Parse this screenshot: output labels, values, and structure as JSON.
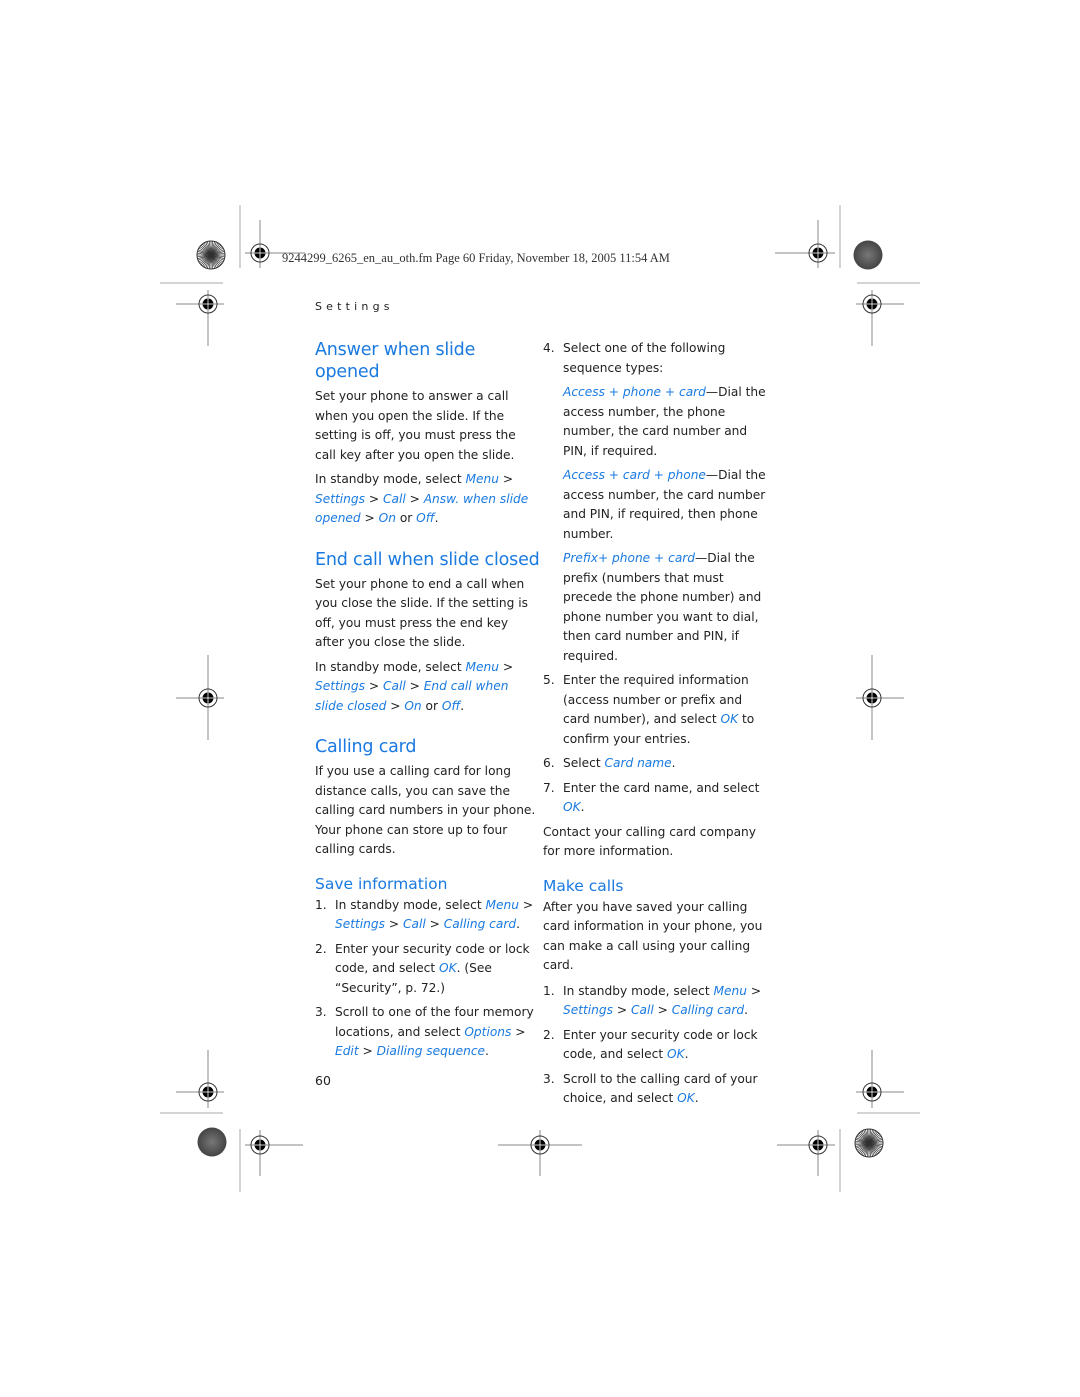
{
  "header": {
    "file_line": "9244299_6265_en_au_oth.fm  Page 60  Friday, November 18, 2005  11:54 AM",
    "running_head": "Settings"
  },
  "left_column": {
    "answer": {
      "title": "Answer when slide opened",
      "body": "Set your phone to answer a call when you open the slide. If the setting is off, you must press the call key after you open the slide.",
      "path_prefix": "In standby mode, select ",
      "menu": "Menu",
      "settings": "Settings",
      "call": "Call",
      "option": "Answ. when slide opened",
      "on": "On",
      "or": " or ",
      "off": "Off"
    },
    "endcall": {
      "title": "End call when slide closed",
      "body": "Set your phone to end a call when you close the slide. If the setting is off, you must press the end key after you close the slide.",
      "path_prefix": "In standby mode, select ",
      "menu": "Menu",
      "settings": "Settings",
      "call": "Call",
      "option": "End call when slide closed",
      "on": "On",
      "or": " or ",
      "off": "Off"
    },
    "calling_card": {
      "title": "Calling card",
      "body": "If you use a calling card for long distance calls, you can save the calling card numbers in your phone. Your phone can store up to four calling cards."
    },
    "save_info": {
      "title": "Save information",
      "steps": [
        {
          "num": "1.",
          "text": "In standby mode, select ",
          "links": [
            "Menu",
            "Settings",
            "Call",
            "Calling card"
          ]
        },
        {
          "num": "2.",
          "text": "Enter your security code or lock code, and select ",
          "link": "OK",
          "after": ". (See “Security”, p. 72.)"
        },
        {
          "num": "3.",
          "text": "Scroll to one of the four memory locations, and select ",
          "links": [
            "Options",
            "Edit",
            "Dialling sequence"
          ]
        }
      ]
    }
  },
  "right_column": {
    "step4": {
      "num": "4.",
      "text": "Select one of the following sequence types:"
    },
    "sequence_types": [
      {
        "name": "Access + phone + card",
        "desc": "—Dial the access number, the phone number, the card number and PIN, if required."
      },
      {
        "name": "Access + card + phone",
        "desc": "—Dial the access number, the card number and PIN, if required, then phone number."
      },
      {
        "name": "Prefix+ phone + card",
        "desc": "—Dial the prefix (numbers that must precede the phone number) and phone number you want to dial, then card number and PIN, if required."
      }
    ],
    "step5": {
      "num": "5.",
      "text": "Enter the required information (access number or prefix and card number), and select ",
      "link": "OK",
      "after": " to confirm your entries."
    },
    "step6": {
      "num": "6.",
      "text": "Select ",
      "link": "Card name",
      "after": "."
    },
    "step7": {
      "num": "7.",
      "text": "Enter the card name, and select ",
      "link": "OK",
      "after": "."
    },
    "contact": "Contact your calling card company for more information.",
    "make_calls": {
      "title": "Make calls",
      "body": "After you have saved your calling card information in your phone, you can make a call using your calling card.",
      "steps": [
        {
          "num": "1.",
          "text": "In standby mode, select ",
          "links": [
            "Menu",
            "Settings",
            "Call",
            "Calling card"
          ]
        },
        {
          "num": "2.",
          "text": "Enter your security code or lock code, and select ",
          "link": "OK",
          "after": "."
        },
        {
          "num": "3.",
          "text": "Scroll to the calling card of your choice, and select ",
          "link": "OK",
          "after": "."
        }
      ]
    }
  },
  "footer": {
    "page_number": "60"
  },
  "colors": {
    "link_blue": "#1a7ae0",
    "text": "#222222",
    "registration_gray": "#999999"
  }
}
